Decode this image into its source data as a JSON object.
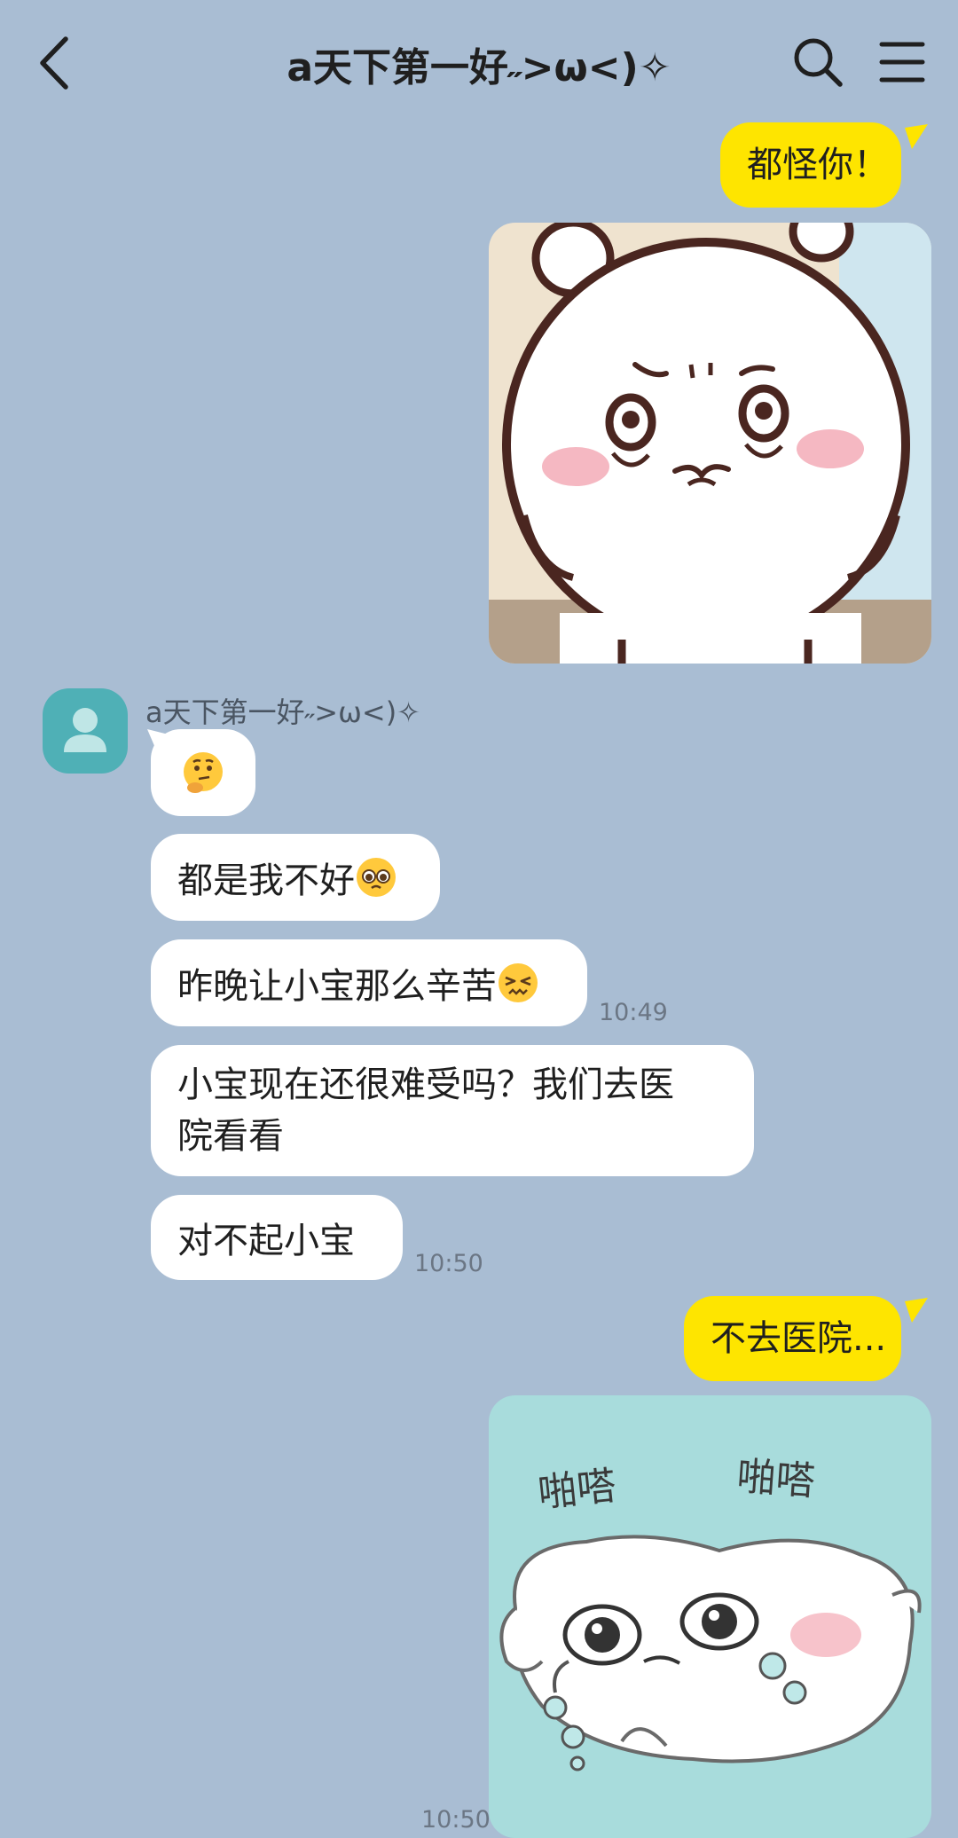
{
  "header": {
    "title": "a天下第一好˶>ω<)✧",
    "back_icon": "chevron-left-icon",
    "search_icon": "search-icon",
    "menu_icon": "hamburger-menu-icon"
  },
  "colors": {
    "background": "#a9bdd3",
    "outgoing_bubble": "#fee500",
    "incoming_bubble": "#ffffff",
    "avatar": "#4fb0b6"
  },
  "messages": {
    "out1": {
      "text": "都怪你！"
    },
    "out_img1": {
      "description_icon": "sticker-angry-bear"
    },
    "sender": {
      "name": "a天下第一好˶>ω<)✧"
    },
    "in1": {
      "emoji": "thinking-face-emoji"
    },
    "in2": {
      "text": "都是我不好",
      "emoji": "pleading-face-emoji"
    },
    "in3": {
      "text": "昨晚让小宝那么辛苦",
      "emoji": "confounded-face-emoji",
      "time": "10:49"
    },
    "in4": {
      "line1": "小宝现在还很难受吗？我们去医",
      "line2": "院看看"
    },
    "in5": {
      "text": "对不起小宝",
      "time": "10:50"
    },
    "out2": {
      "text": "不去医院..."
    },
    "out_img2": {
      "caption_left": "啪嗒",
      "caption_right": "啪嗒",
      "time": "10:50"
    }
  }
}
